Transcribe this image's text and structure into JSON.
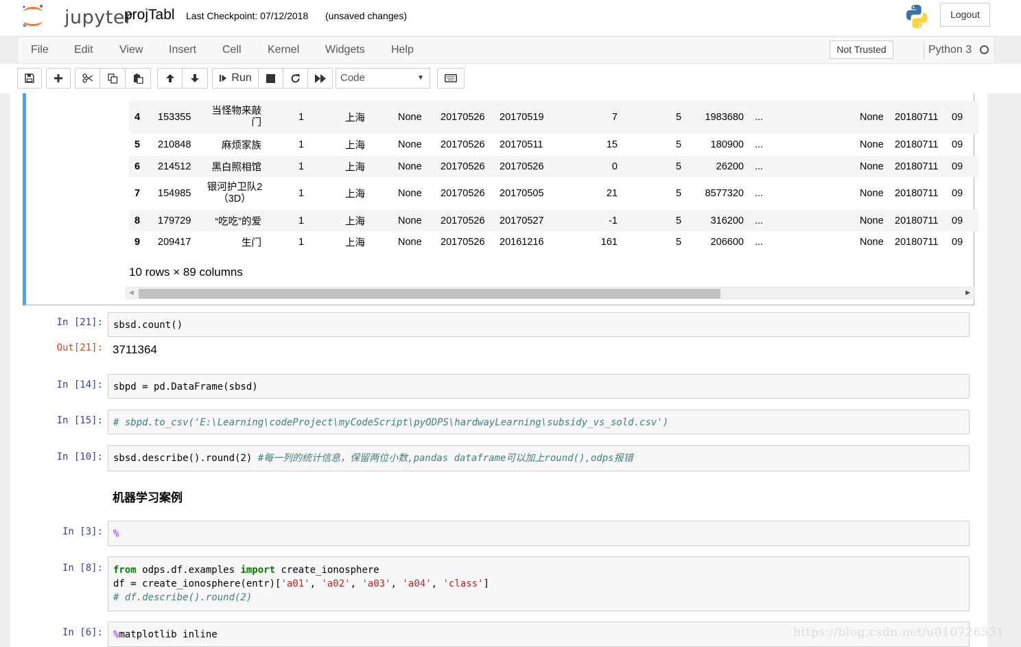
{
  "header": {
    "logo_text": "jupyter",
    "notebook_name": "projTabl",
    "checkpoint": "Last Checkpoint: 07/12/2018",
    "autosave_status": "(unsaved changes)",
    "logout_label": "Logout"
  },
  "menubar": {
    "items": [
      "File",
      "Edit",
      "View",
      "Insert",
      "Cell",
      "Kernel",
      "Widgets",
      "Help"
    ],
    "trust_label": "Not Trusted",
    "kernel_name": "Python 3"
  },
  "toolbar": {
    "run_label": "Run",
    "cell_type": "Code",
    "icons": [
      "save-icon",
      "plus-icon",
      "scissors-icon",
      "copy-icon",
      "paste-icon",
      "arrow-up-icon",
      "arrow-down-icon",
      "step-forward-icon",
      "stop-icon",
      "refresh-icon",
      "fast-forward-icon",
      "keyboard-icon"
    ]
  },
  "dataframe": {
    "rows": [
      [
        "4",
        "153355",
        "当怪物来敲门",
        "1",
        "上海",
        "None",
        "20170526",
        "20170519",
        "7",
        "5",
        "1983680",
        "...",
        "None",
        "20180711",
        "09"
      ],
      [
        "5",
        "210848",
        "麻烦家族",
        "1",
        "上海",
        "None",
        "20170526",
        "20170511",
        "15",
        "5",
        "180900",
        "...",
        "None",
        "20180711",
        "09"
      ],
      [
        "6",
        "214512",
        "黑白照相馆",
        "1",
        "上海",
        "None",
        "20170526",
        "20170526",
        "0",
        "5",
        "26200",
        "...",
        "None",
        "20180711",
        "09"
      ],
      [
        "7",
        "154985",
        "银河护卫队2（3D）",
        "1",
        "上海",
        "None",
        "20170526",
        "20170505",
        "21",
        "5",
        "8577320",
        "...",
        "None",
        "20180711",
        "09"
      ],
      [
        "8",
        "179729",
        "“吃吃”的爱",
        "1",
        "上海",
        "None",
        "20170526",
        "20170527",
        "-1",
        "5",
        "316200",
        "...",
        "None",
        "20180711",
        "09"
      ],
      [
        "9",
        "209417",
        "生门",
        "1",
        "上海",
        "None",
        "20170526",
        "20161216",
        "161",
        "5",
        "206600",
        "...",
        "None",
        "20180711",
        "09"
      ]
    ],
    "summary": "10 rows × 89 columns"
  },
  "cells": {
    "c1": {
      "prompt": "In [21]:",
      "code": "sbsd.count()"
    },
    "c1_out": {
      "prompt": "Out[21]:",
      "value": "3711364"
    },
    "c2": {
      "prompt": "In [14]:",
      "code": "sbpd = pd.DataFrame(sbsd)"
    },
    "c3": {
      "prompt": "In [15]:",
      "comment": "# sbpd.to_csv('E:\\Learning\\codeProject\\myCodeScript\\pyODPS\\hardwayLearning\\subsidy_vs_sold.csv')"
    },
    "c4": {
      "prompt": "In [10]:",
      "code": "sbsd.describe().round(2) ",
      "comment": "#每一列的统计信息，保留两位小数,pandas dataframe可以加上round(),odps报错"
    },
    "md_heading": "机器学习案例",
    "c5": {
      "prompt": "In [3]:",
      "magic": "%"
    },
    "c6": {
      "prompt": "In [8]:",
      "kw_from": "from",
      "module": " odps.df.examples ",
      "kw_import": "import",
      "name": " create_ionosphere",
      "line2_a": "df = create_ionosphere(entr)[",
      "str1": "'a01'",
      "str2": "'a02'",
      "str3": "'a03'",
      "str4": "'a04'",
      "str5": "'class'",
      "sep": ", ",
      "line2_b": "]",
      "line3_comment": "# df.describe().round(2)"
    },
    "c7": {
      "prompt": "In [6]:",
      "magic": "%",
      "code": "matplotlib inline"
    }
  },
  "watermark": "https://blog.csdn.net/u010726531",
  "colors": {
    "selected_cell_bar": "#42a5f5",
    "in_prompt": "#303f9f",
    "out_prompt": "#d84315",
    "comment": "#408080",
    "keyword": "#008000",
    "string": "#ba2121",
    "magic": "#aa22ff"
  }
}
